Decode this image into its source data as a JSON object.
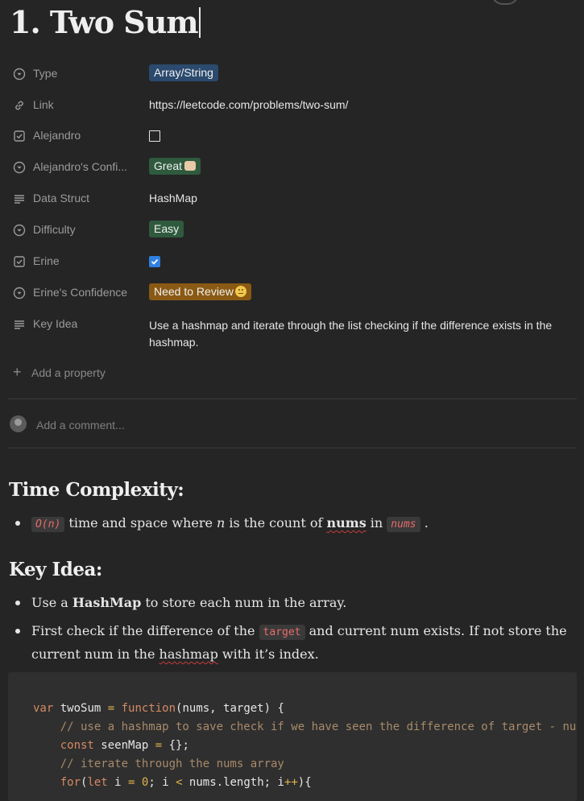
{
  "page": {
    "title": "1. Two Sum"
  },
  "properties": [
    {
      "name": "Type",
      "icon": "select-icon",
      "kind": "pill",
      "value": "Array/String",
      "color": "#2b4a6e"
    },
    {
      "name": "Link",
      "icon": "link-icon",
      "kind": "text",
      "value": "https://leetcode.com/problems/two-sum/"
    },
    {
      "name": "Alejandro",
      "icon": "checkbox-icon",
      "kind": "checkbox",
      "checked": false
    },
    {
      "name": "Alejandro's Confi...",
      "icon": "select-icon",
      "kind": "pill",
      "value": "Great",
      "emoji": "thumbs-up",
      "color": "#2f5a3e"
    },
    {
      "name": "Data Struct",
      "icon": "text-lines-icon",
      "kind": "text",
      "value": "HashMap"
    },
    {
      "name": "Difficulty",
      "icon": "select-icon",
      "kind": "pill",
      "value": "Easy",
      "color": "#2f5a3e"
    },
    {
      "name": "Erine",
      "icon": "checkbox-icon",
      "kind": "checkbox",
      "checked": true
    },
    {
      "name": "Erine's Confidence",
      "icon": "select-icon",
      "kind": "pill",
      "value": "Need to Review",
      "emoji": "neutral-face",
      "color": "#8a5a14"
    },
    {
      "name": "Key Idea",
      "icon": "text-lines-icon",
      "kind": "text",
      "value": "Use a hashmap and iterate through the list checking if the difference exists in the hashmap."
    }
  ],
  "add_property_label": "Add a property",
  "comment": {
    "placeholder": "Add a comment..."
  },
  "content": {
    "time_complexity_heading": "Time Complexity:",
    "tc_bullet": {
      "code1": "O(n)",
      "text1": " time and space where ",
      "em": "n",
      "text2": " is the count of ",
      "bold": "nums",
      "text3": " in ",
      "code2": "nums",
      "text4": " ."
    },
    "key_idea_heading": "Key Idea:",
    "ki_bullet1": {
      "text1": "Use a ",
      "bold": "HashMap",
      "text2": " to store each num in the array."
    },
    "ki_bullet2": {
      "text1": "First check if the difference of the ",
      "code": "target",
      "text2": " and current num exists. If not store the current num in the ",
      "squig": "hashmap",
      "text3": " with it’s index."
    }
  },
  "code": {
    "line1": {
      "kw1": "var",
      "name": " twoSum ",
      "op": "=",
      "kw2": " function",
      "rest": "(nums, target) {"
    },
    "line2": "    // use a hashmap to save check if we have seen the difference of target - num",
    "line3": {
      "indent": "    ",
      "kw": "const",
      "rest": " seenMap ",
      "op": "=",
      "rest2": " {};"
    },
    "line4": "    // iterate through the nums array",
    "line5": {
      "indent": "    ",
      "kw1": "for",
      "p1": "(",
      "kw2": "let",
      "p2": " i ",
      "op1": "=",
      "num": " 0",
      "p3": "; i ",
      "op2": "<",
      "p4": " nums.length; i",
      "op3": "++",
      "p5": "){"
    }
  },
  "colors": {
    "background": "#252525",
    "pill_blue": "#2b4a6e",
    "pill_green": "#2f5a3e",
    "pill_orange": "#8a5a14",
    "checkbox_checked": "#2f80e0",
    "inline_code": "#e86b6b"
  }
}
